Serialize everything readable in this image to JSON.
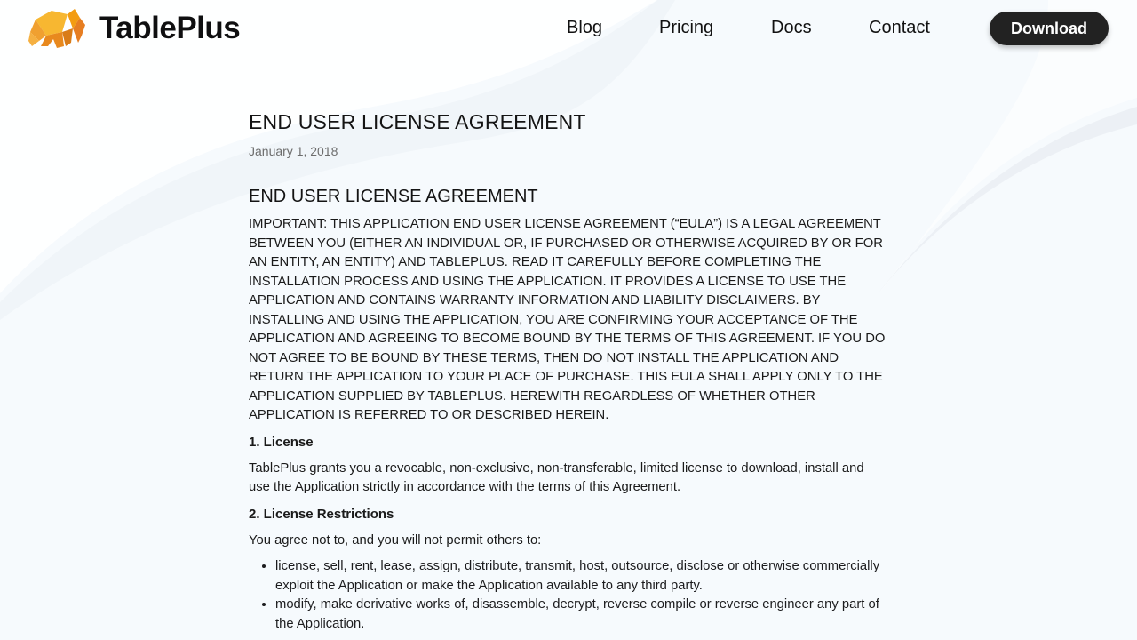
{
  "header": {
    "brand": "TablePlus",
    "nav": [
      {
        "label": "Blog"
      },
      {
        "label": "Pricing"
      },
      {
        "label": "Docs"
      },
      {
        "label": "Contact"
      }
    ],
    "download_label": "Download"
  },
  "article": {
    "title": "END USER LICENSE AGREEMENT",
    "date": "January 1, 2018",
    "section_heading": "END USER LICENSE AGREEMENT",
    "intro": "IMPORTANT: THIS APPLICATION END USER LICENSE AGREEMENT (“EULA”) IS A LEGAL AGREEMENT BETWEEN YOU (EITHER AN INDIVIDUAL OR, IF PURCHASED OR OTHERWISE ACQUIRED BY OR FOR AN ENTITY, AN ENTITY) AND TABLEPLUS. READ IT CAREFULLY BEFORE COMPLETING THE INSTALLATION PROCESS AND USING THE APPLICATION. IT PROVIDES A LICENSE TO USE THE APPLICATION AND CONTAINS WARRANTY INFORMATION AND LIABILITY DISCLAIMERS. BY INSTALLING AND USING THE APPLICATION, YOU ARE CONFIRMING YOUR ACCEPTANCE OF THE APPLICATION AND AGREEING TO BECOME BOUND BY THE TERMS OF THIS AGREEMENT. IF YOU DO NOT AGREE TO BE BOUND BY THESE TERMS, THEN DO NOT INSTALL THE APPLICATION AND RETURN THE APPLICATION TO YOUR PLACE OF PURCHASE. THIS EULA SHALL APPLY ONLY TO THE APPLICATION SUPPLIED BY TABLEPLUS. HEREWITH REGARDLESS OF WHETHER OTHER APPLICATION IS REFERRED TO OR DESCRIBED HEREIN.",
    "license_heading": "1. License",
    "license_text": "TablePlus grants you a revocable, non-exclusive, non-transferable, limited license to download, install and use the Application strictly in accordance with the terms of this Agreement.",
    "restrictions_heading": "2. License Restrictions",
    "restrictions_intro": "You agree not to, and you will not permit others to:",
    "restrictions": [
      "license, sell, rent, lease, assign, distribute, transmit, host, outsource, disclose or otherwise commercially exploit the Application or make the Application available to any third party.",
      "modify, make derivative works of, disassemble, decrypt, reverse compile or reverse engineer any part of the Application."
    ]
  },
  "colors": {
    "background": "#f6fafd",
    "button_bg": "#222222",
    "logo_orange": "#f5a623"
  },
  "icons": {
    "logo": "elephant-logo-icon"
  }
}
